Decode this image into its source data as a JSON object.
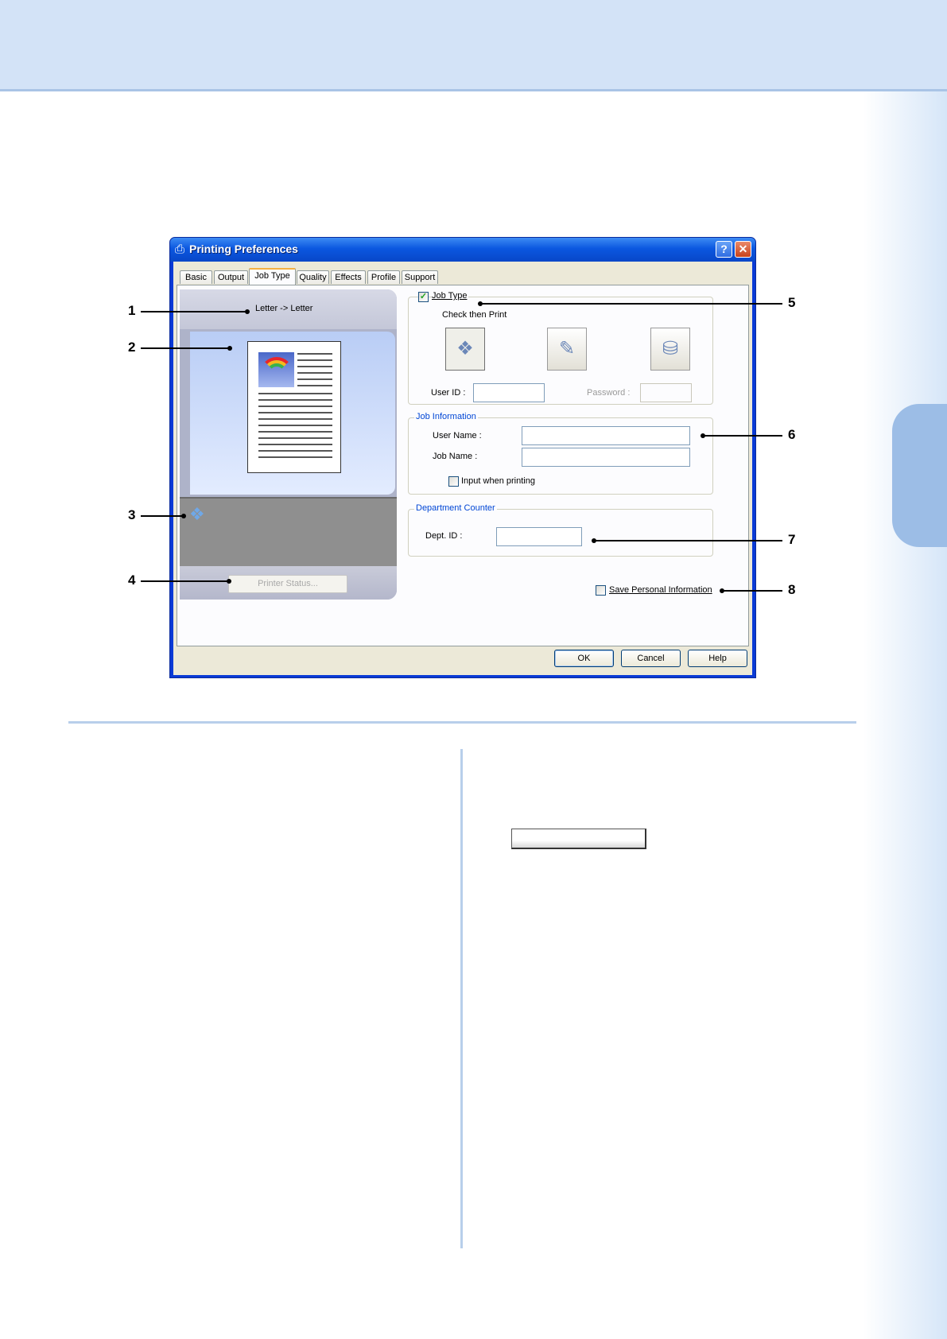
{
  "window": {
    "title": "Printing Preferences",
    "help_button": "?",
    "close_button": "✕",
    "tabs": [
      "Basic",
      "Output",
      "Job Type",
      "Quality",
      "Effects",
      "Profile",
      "Support"
    ],
    "active_tab": "Job Type"
  },
  "preview": {
    "paper_size": "Letter -> Letter",
    "printer_status_button": "Printer Status..."
  },
  "job_type": {
    "checkbox_label": "Job Type",
    "checked": true,
    "mode_label": "Check then Print",
    "user_id_label": "User ID :",
    "user_id_value": "",
    "password_label": "Password :",
    "password_value": ""
  },
  "job_information": {
    "legend": "Job Information",
    "user_name_label": "User Name :",
    "user_name_value": "",
    "job_name_label": "Job Name :",
    "job_name_value": "",
    "input_when_printing_label": "Input when printing",
    "input_when_printing_checked": false
  },
  "department_counter": {
    "legend": "Department Counter",
    "dept_id_label": "Dept. ID :",
    "dept_id_value": ""
  },
  "save_personal_information": {
    "label": "Save Personal Information",
    "checked": false
  },
  "buttons": {
    "ok": "OK",
    "cancel": "Cancel",
    "help": "Help"
  },
  "callouts": [
    "1",
    "2",
    "3",
    "4",
    "5",
    "6",
    "7",
    "8"
  ],
  "colors": {
    "titlebar": "#0b57e0",
    "dialog_face": "#ece9d8",
    "page_band": "#d3e3f7",
    "side_tab": "#9cbde6"
  }
}
